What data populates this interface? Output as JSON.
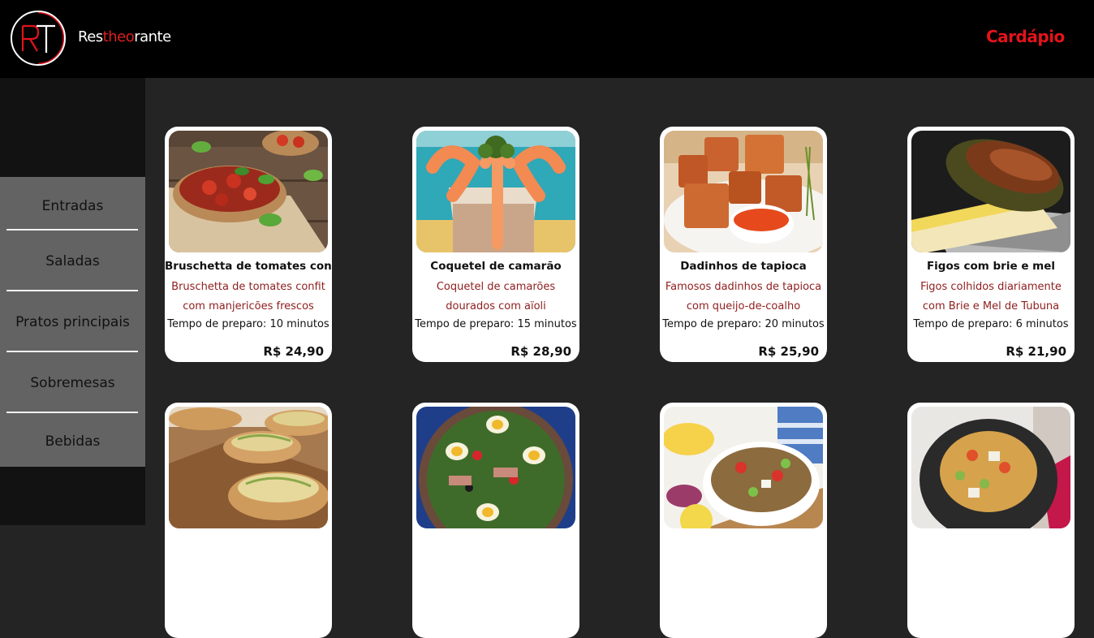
{
  "header": {
    "logo_letters": "RT",
    "brand_prefix": "Res",
    "brand_highlight": "theo",
    "brand_suffix": "rante",
    "nav_link": "Cardápio",
    "accent_color": "#e3131b"
  },
  "sidebar": {
    "items": [
      {
        "label": "Entradas"
      },
      {
        "label": "Saladas"
      },
      {
        "label": "Pratos principais"
      },
      {
        "label": "Sobremesas"
      },
      {
        "label": "Bebidas"
      }
    ]
  },
  "menu_cards": [
    {
      "photo": "bruschetta-photo",
      "title": "Bruschetta de tomates confit",
      "description": "Bruschetta de tomates confit com manjericões frescos",
      "prep_time": "Tempo de preparo: 10 minutos",
      "price": "R$ 24,90"
    },
    {
      "photo": "shrimp-cocktail-photo",
      "title": "Coquetel de camarão",
      "description": "Coquetel de camarões dourados com aïoli",
      "prep_time": "Tempo de preparo: 15 minutos",
      "price": "R$ 28,90"
    },
    {
      "photo": "tapioca-cubes-photo",
      "title": "Dadinhos de tapioca",
      "description": "Famosos dadinhos de tapioca com queijo-de-coalho",
      "prep_time": "Tempo de preparo: 20 minutos",
      "price": "R$ 25,90"
    },
    {
      "photo": "figs-brie-photo",
      "title": "Figos com brie e mel",
      "description": "Figos colhidos diariamente com Brie e Mel de Tubuna",
      "prep_time": "Tempo de preparo: 6 minutos",
      "price": "R$ 21,90"
    },
    {
      "photo": "crostini-photo"
    },
    {
      "photo": "nicoise-salad-photo"
    },
    {
      "photo": "lentil-salad-photo"
    },
    {
      "photo": "pasta-salad-photo"
    }
  ]
}
